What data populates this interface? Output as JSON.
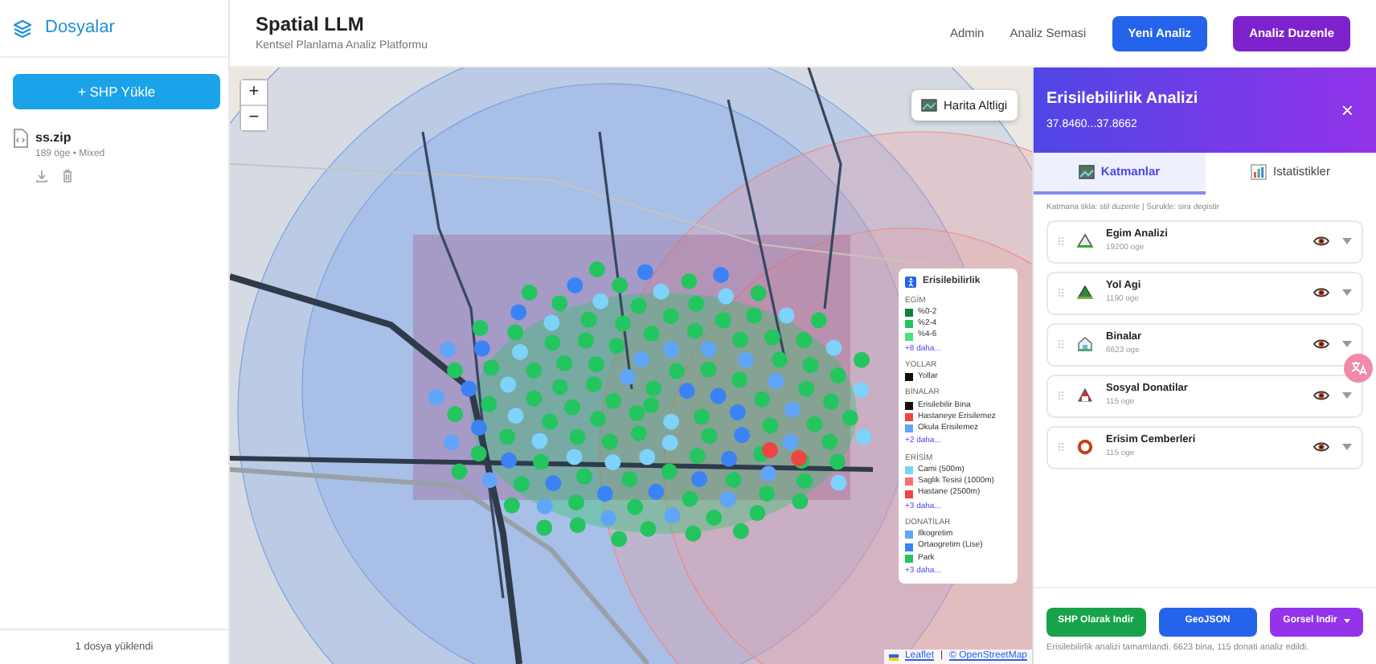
{
  "sidebar": {
    "title": "Dosyalar",
    "upload_button": "+ SHP Yükle",
    "files": [
      {
        "name": "ss.zip",
        "meta": "189 öge • Mixed"
      }
    ],
    "footer": "1 dosya yüklendi"
  },
  "header": {
    "title": "Spatial LLM",
    "subtitle": "Kentsel Planlama Analiz Platformu",
    "links": [
      "Admin",
      "Analiz Semasi"
    ],
    "buttons": [
      {
        "label": "Yeni Analiz",
        "kind": "primary"
      },
      {
        "label": "Analiz Duzenle",
        "kind": "purple"
      }
    ]
  },
  "map": {
    "zoom_in": "+",
    "zoom_out": "−",
    "basemap_button": "Harita Altligi",
    "attribution": [
      "Leaflet",
      "|",
      "© OpenStreetMap"
    ],
    "legend": {
      "title": "Erisilebilirlik",
      "sections": [
        {
          "title": "EGİM",
          "items": [
            {
              "label": "%0-2",
              "color": "#15803d"
            },
            {
              "label": "%2-4",
              "color": "#22c55e"
            },
            {
              "label": "%4-6",
              "color": "#4ade80"
            }
          ],
          "more": "+8 daha..."
        },
        {
          "title": "YOLLAR",
          "items": [
            {
              "label": "Yollar",
              "color": "#111111"
            }
          ]
        },
        {
          "title": "BİNALAR",
          "items": [
            {
              "label": "Erisilebilir Bina",
              "color": "#111111"
            },
            {
              "label": "Hastaneye Erisilemez",
              "color": "#ef4444"
            },
            {
              "label": "Okula Erisilemez",
              "color": "#60a5fa"
            }
          ],
          "more": "+2 daha..."
        },
        {
          "title": "ERİSİM",
          "items": [
            {
              "label": "Cami (500m)",
              "color": "#7dd3fc"
            },
            {
              "label": "Saglik Tesisi (1000m)",
              "color": "#f87171"
            },
            {
              "label": "Hastane (2500m)",
              "color": "#ef4444"
            }
          ],
          "more": "+3 daha..."
        },
        {
          "title": "DONATİLAR",
          "items": [
            {
              "label": "Ilkogretim",
              "color": "#60a5fa"
            },
            {
              "label": "Ortaogretim (Lise)",
              "color": "#3b82f6"
            },
            {
              "label": "Park",
              "color": "#22c55e"
            }
          ],
          "more": "+3 daha..."
        }
      ]
    }
  },
  "panel": {
    "title": "Erisilebilirlik Analizi",
    "subtitle": "37.8460...37.8662",
    "close": "×",
    "tabs": [
      {
        "label": "Katmanlar",
        "selected": true
      },
      {
        "label": "Istatistikler",
        "selected": false
      }
    ],
    "hint": "Katmana tikla: stil duzenle | Surukle: sira degistir",
    "layers": [
      {
        "name": "Egim Analizi",
        "count": "19200 oge"
      },
      {
        "name": "Yol Agi",
        "count": "1190 oge"
      },
      {
        "name": "Binalar",
        "count": "6623 oge"
      },
      {
        "name": "Sosyal Donatilar",
        "count": "115 oge"
      },
      {
        "name": "Erisim Cemberleri",
        "count": "115 oge"
      }
    ],
    "buttons": [
      {
        "label": "SHP Olarak Indir",
        "kind": "green"
      },
      {
        "label": "GeoJSON",
        "kind": "blue"
      },
      {
        "label": "Gorsel Indir",
        "kind": "dropdown"
      }
    ],
    "status": "Erisilebilirlik analizi tamamlandi. 6623 bina, 115 donati analiz edildi."
  }
}
